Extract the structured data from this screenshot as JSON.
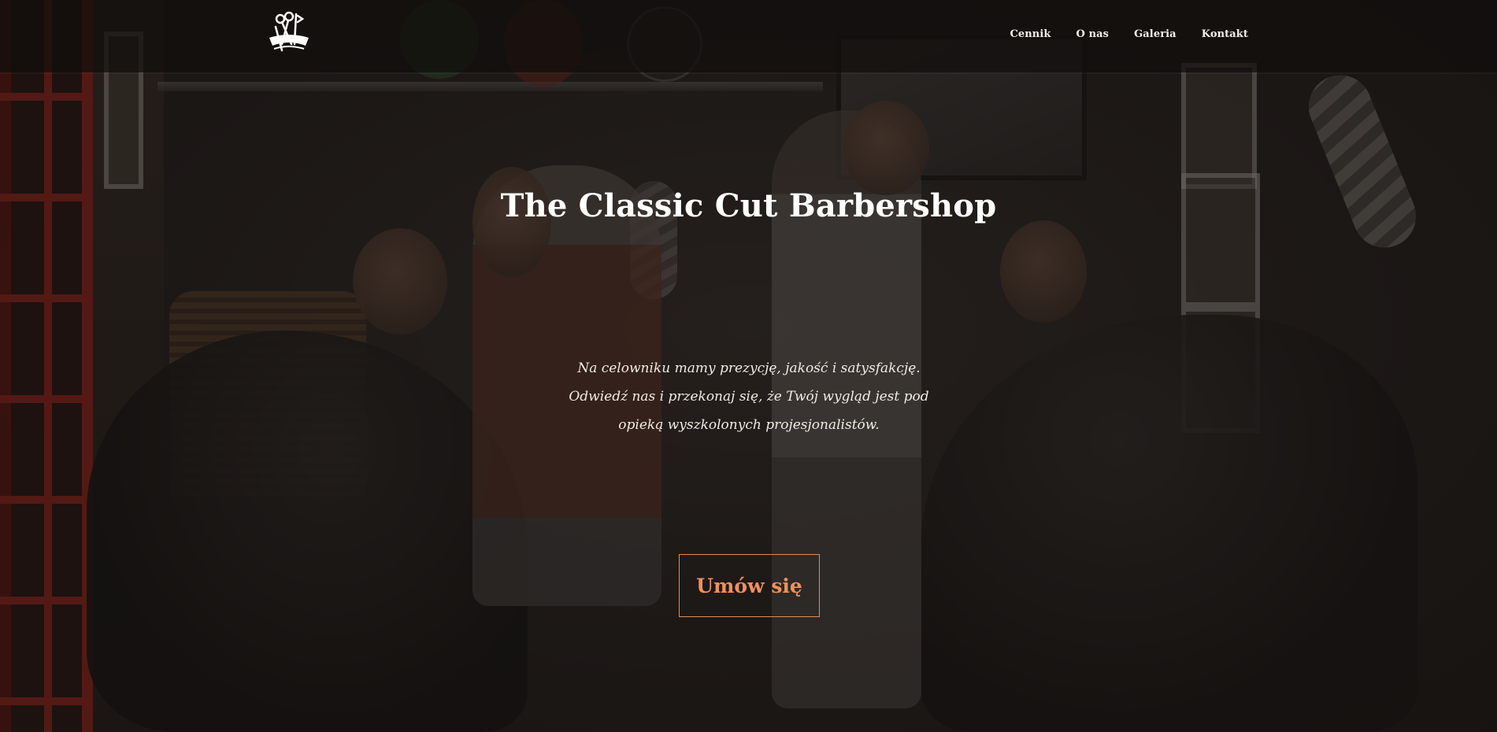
{
  "nav": {
    "logo_icon": "barbershop-scissors-logo-icon",
    "links": [
      {
        "label": "Cennik"
      },
      {
        "label": "O nas"
      },
      {
        "label": "Galeria"
      },
      {
        "label": "Kontakt"
      }
    ]
  },
  "hero": {
    "title": "The Classic Cut Barbershop",
    "description": "Na celowniku mamy prezycję, jakość i satysfakcję. Odwiedź nas i przekonaj się, że Twój wygląd jest pod opieką wyszkolonych projesjonalistów.",
    "cta_label": "Umów się"
  },
  "colors": {
    "accent": "#e58c55",
    "text": "#ffffff",
    "navbar_bg": "#100e0d"
  }
}
